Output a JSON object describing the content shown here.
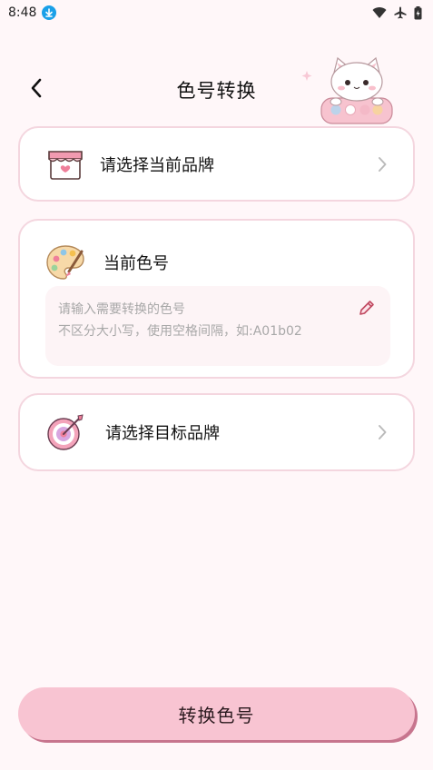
{
  "status_bar": {
    "time": "8:48"
  },
  "header": {
    "title": "色号转换"
  },
  "source_brand": {
    "label": "请选择当前品牌"
  },
  "current_color": {
    "label": "当前色号",
    "placeholder_line1": "请输入需要转换的色号",
    "placeholder_line2": "不区分大小写，使用空格间隔，如:A01b02"
  },
  "target_brand": {
    "label": "请选择目标品牌"
  },
  "convert_button": {
    "label": "转换色号"
  },
  "colors": {
    "background": "#fff7f9",
    "card_border": "#f4d6df",
    "button": "#f8c4d2",
    "button_shadow": "#c7758e"
  }
}
